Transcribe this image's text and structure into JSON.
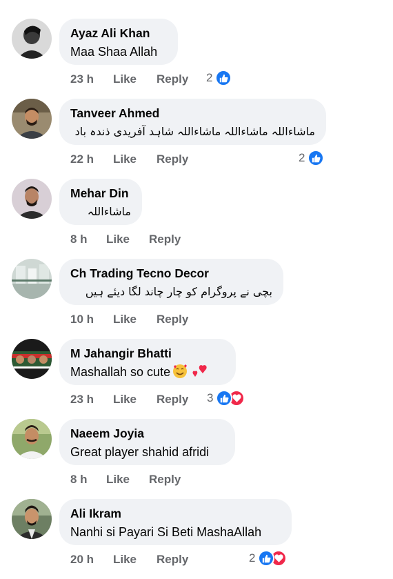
{
  "comments": [
    {
      "name": "Ayaz Ali Khan",
      "text": "Maa Shaa Allah",
      "rtl": false,
      "time": "23 h",
      "like": "Like",
      "reply": "Reply",
      "reaction_count": "2",
      "reactions": [
        "like"
      ]
    },
    {
      "name": "Tanveer Ahmed",
      "text": "ماشاءاللہ ماشاءاللہ ماشاءاللہ شاہد آفریدی ذندہ باد",
      "rtl": true,
      "time": "22 h",
      "like": "Like",
      "reply": "Reply",
      "reaction_count": "2",
      "reactions": [
        "like"
      ]
    },
    {
      "name": "Mehar Din",
      "text": "ماشاءاللہ",
      "rtl": true,
      "time": "8 h",
      "like": "Like",
      "reply": "Reply",
      "reaction_count": "",
      "reactions": []
    },
    {
      "name": "Ch Trading Tecno Decor",
      "text": "بچی نے پروگرام کو چار چاند لگا دیئے ہیں",
      "rtl": true,
      "time": "10 h",
      "like": "Like",
      "reply": "Reply",
      "reaction_count": "",
      "reactions": []
    },
    {
      "name": "M Jahangir Bhatti",
      "text": "Mashallah so cute",
      "rtl": false,
      "emojis": [
        "smiling-face-with-hearts-emoji",
        "two-hearts-emoji"
      ],
      "time": "23 h",
      "like": "Like",
      "reply": "Reply",
      "reaction_count": "3",
      "reactions": [
        "like",
        "love"
      ]
    },
    {
      "name": "Naeem Joyia",
      "text": "Great player shahid afridi",
      "rtl": false,
      "time": "8 h",
      "like": "Like",
      "reply": "Reply",
      "reaction_count": "",
      "reactions": []
    },
    {
      "name": "Ali Ikram",
      "text": "Nanhi si Payari Si Beti MashaAllah",
      "rtl": false,
      "time": "20 h",
      "like": "Like",
      "reply": "Reply",
      "reaction_count": "2",
      "reactions": [
        "like",
        "love"
      ]
    }
  ],
  "colors": {
    "bubble": "#f0f2f5",
    "meta": "#65676b",
    "like_blue": "#1877f2",
    "love_red": "#f0284a"
  }
}
